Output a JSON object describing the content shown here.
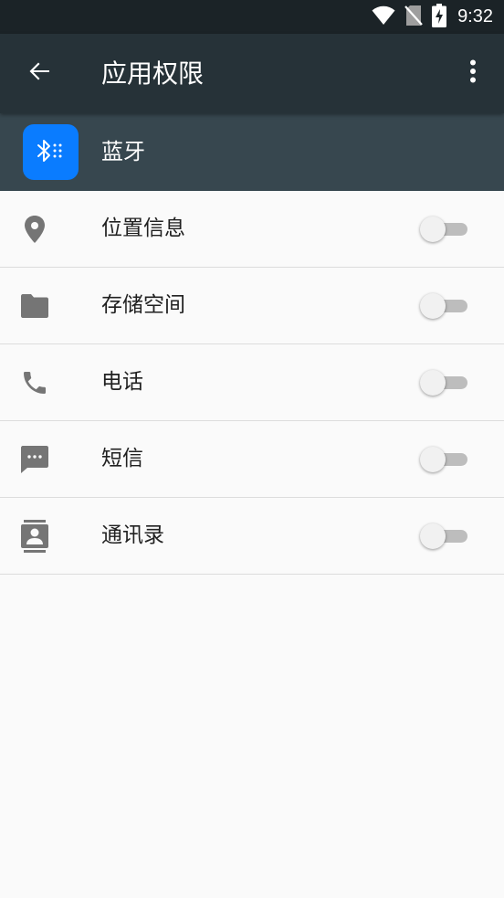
{
  "status_bar": {
    "time": "9:32",
    "icons": [
      "wifi-icon",
      "no-sim-icon",
      "battery-charging-icon"
    ]
  },
  "app_bar": {
    "title": "应用权限",
    "back_icon": "arrow-back-icon",
    "more_icon": "more-vert-icon"
  },
  "app": {
    "name": "蓝牙",
    "icon": "bluetooth-icon",
    "icon_color": "#0a7cff"
  },
  "permissions": [
    {
      "label": "位置信息",
      "icon": "location-icon",
      "enabled": false
    },
    {
      "label": "存储空间",
      "icon": "folder-icon",
      "enabled": false
    },
    {
      "label": "电话",
      "icon": "phone-icon",
      "enabled": false
    },
    {
      "label": "短信",
      "icon": "message-icon",
      "enabled": false
    },
    {
      "label": "通讯录",
      "icon": "contacts-icon",
      "enabled": false
    }
  ],
  "colors": {
    "status_bar": "#1b2327",
    "app_bar": "#263238",
    "app_header": "#37474f",
    "background": "#fafafa"
  }
}
